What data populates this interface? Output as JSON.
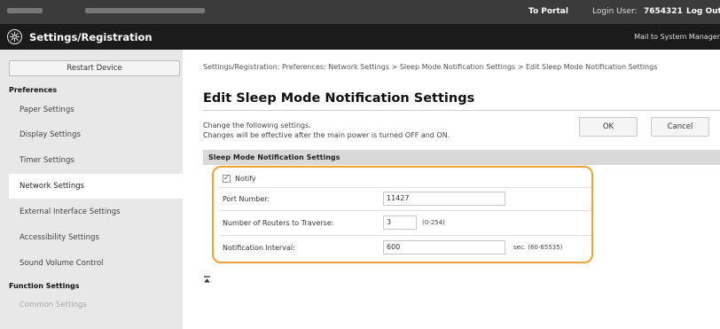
{
  "header": {
    "portal_link": "To Portal",
    "login_user_label": "Login User:",
    "login_user_value": "7654321",
    "logout_link": "Log Out"
  },
  "titlebar": {
    "title": "Settings/Registration",
    "mail_link": "Mail to System Manager"
  },
  "sidebar": {
    "restart_button": "Restart Device",
    "preferences_heading": "Preferences",
    "items": [
      {
        "label": "Paper Settings"
      },
      {
        "label": "Display Settings"
      },
      {
        "label": "Timer Settings"
      },
      {
        "label": "Network Settings"
      },
      {
        "label": "External Interface Settings"
      },
      {
        "label": "Accessibility Settings"
      },
      {
        "label": "Sound Volume Control"
      }
    ],
    "function_heading": "Function Settings",
    "function_items": [
      {
        "label": "Common Settings"
      }
    ]
  },
  "main": {
    "breadcrumb": "Settings/Registration: Preferences: Network Settings > Sleep Mode Notification Settings > Edit Sleep Mode Notification Settings",
    "page_title": "Edit Sleep Mode Notification Settings",
    "desc_line1": "Change the following settings.",
    "desc_line2": "Changes will be effective after the main power is turned OFF and ON.",
    "ok_button": "OK",
    "cancel_button": "Cancel",
    "section_title": "Sleep Mode Notification Settings",
    "notify_label": "Notify",
    "notify_checked": true,
    "port_label": "Port Number:",
    "port_value": "11427",
    "routers_label": "Number of Routers to Traverse:",
    "routers_value": "3",
    "routers_hint": "(0-254)",
    "interval_label": "Notification Interval:",
    "interval_value": "600",
    "interval_hint": "sec. (60-65535)"
  },
  "colors": {
    "highlight": "#f0a33a",
    "title_bar": "#1b1b1b",
    "top_bar": "#3b3b3b"
  }
}
